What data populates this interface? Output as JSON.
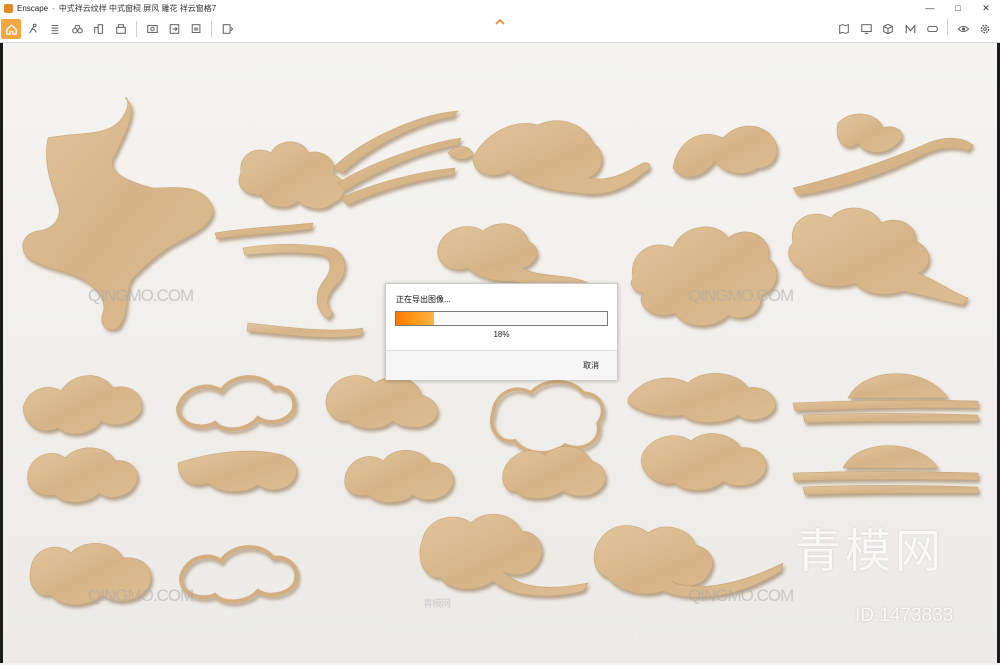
{
  "window": {
    "app_name": "Enscape",
    "doc_title": "中式祥云纹样 中式窗棂 屏风 雕花 祥云窗格7",
    "controls": {
      "minimize": "—",
      "maximize": "□",
      "close": "✕"
    }
  },
  "toolbar": {
    "left_icons": [
      "home-icon",
      "walk-icon",
      "list-icon",
      "binoculars-icon",
      "buildings-icon",
      "library-icon",
      "screenshot-icon",
      "export-icon",
      "batch-render-icon",
      "panorama-icon"
    ],
    "right_icons": [
      "map-icon",
      "monitor-icon",
      "cube-icon",
      "mode-icon",
      "vr-icon",
      "eye-icon",
      "settings-icon"
    ],
    "collapse": "chevron-up-icon",
    "accent": "#f4a640"
  },
  "dialog": {
    "title": "正在导出图像...",
    "progress_percent": 18,
    "progress_label": "18%",
    "cancel_label": "取消"
  },
  "watermarks": {
    "site_logo_text": "QINGMO.COM",
    "site_cn": "青模网",
    "big_text": "青模网",
    "id_text": "ID:1473833"
  },
  "colors": {
    "cloud_fill": "#d9b98e",
    "cloud_shadow": "#b08b5f",
    "wall": "#f2f1ee",
    "progress": "#ff8a00"
  }
}
